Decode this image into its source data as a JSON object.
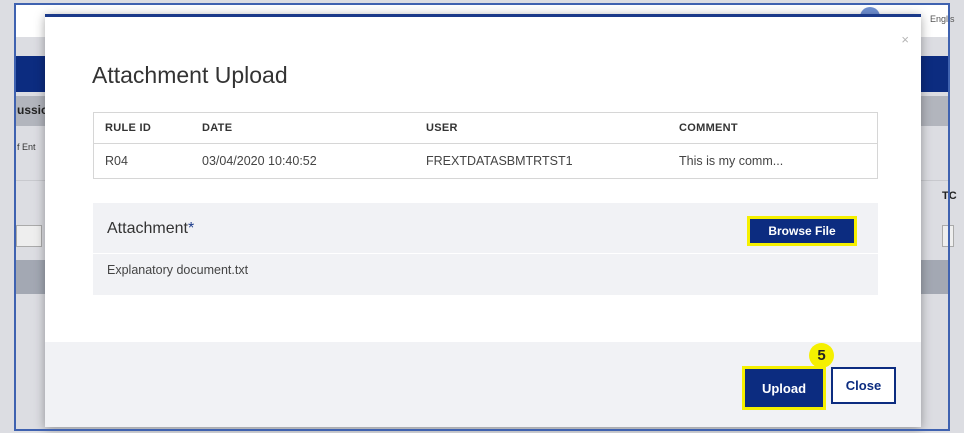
{
  "background": {
    "language_label": "Englis",
    "left_section_label": "ussio",
    "left_small_label": "f Ent",
    "right_column_label": "TC"
  },
  "modal": {
    "title": "Attachment Upload",
    "close_icon": "close-icon",
    "table": {
      "headers": [
        "RULE ID",
        "DATE",
        "USER",
        "COMMENT"
      ],
      "rows": [
        [
          "R04",
          "03/04/2020 10:40:52",
          "FREXTDATASBMTRTST1",
          "This is my comm..."
        ]
      ]
    },
    "attachment": {
      "label": "Attachment",
      "required_marker": "*",
      "browse_label": "Browse File",
      "file_name": "Explanatory document.txt"
    },
    "footer": {
      "upload_label": "Upload",
      "close_label": "Close"
    }
  },
  "annotation": {
    "step_number": "5"
  },
  "colors": {
    "brand_navy": "#0c2c80",
    "highlight_yellow": "#f5f000",
    "panel_gray": "#f1f2f5"
  }
}
